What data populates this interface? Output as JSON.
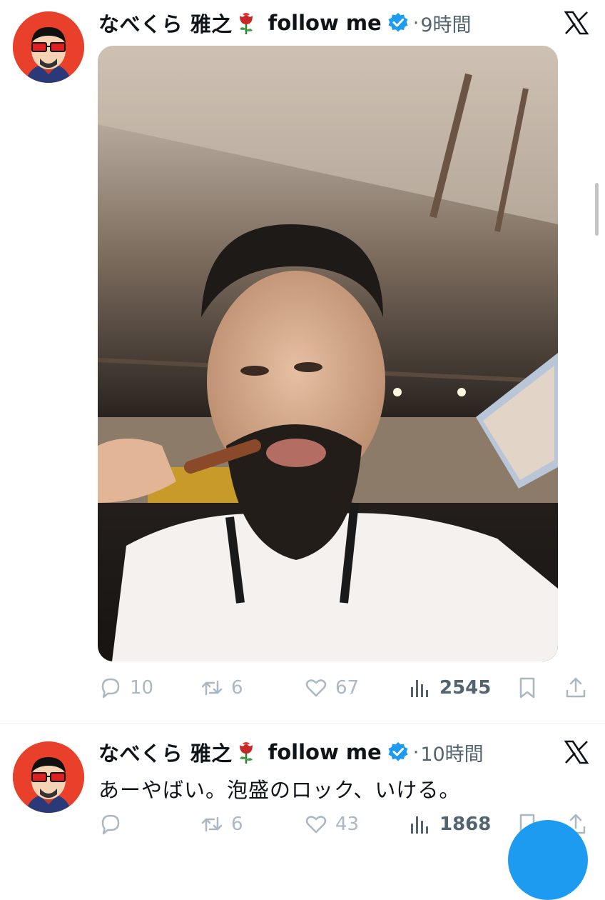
{
  "tweets": [
    {
      "display_name": "なべくら 雅之",
      "name_suffix": "follow me",
      "time": "9時間",
      "text": "",
      "stats": {
        "replies": "10",
        "retweets": "6",
        "likes": "67",
        "views": "2545"
      }
    },
    {
      "display_name": "なべくら 雅之",
      "name_suffix": "follow me",
      "time": "10時間",
      "text": "あーやばい。泡盛のロック、いける。",
      "stats": {
        "replies": "",
        "retweets": "6",
        "likes": "43",
        "views": "1868"
      }
    }
  ],
  "icons": {
    "brand": "x-logo",
    "badge": "verified-badge",
    "emoji": "rose",
    "actions": [
      "reply-icon",
      "retweet-icon",
      "like-icon",
      "views-icon",
      "bookmark-icon",
      "share-icon"
    ]
  },
  "colors": {
    "verified": "#1d9bf0",
    "avatar_bg": "#e8402b",
    "muted": "#aab8c2",
    "fab": "#1d9bf0"
  }
}
